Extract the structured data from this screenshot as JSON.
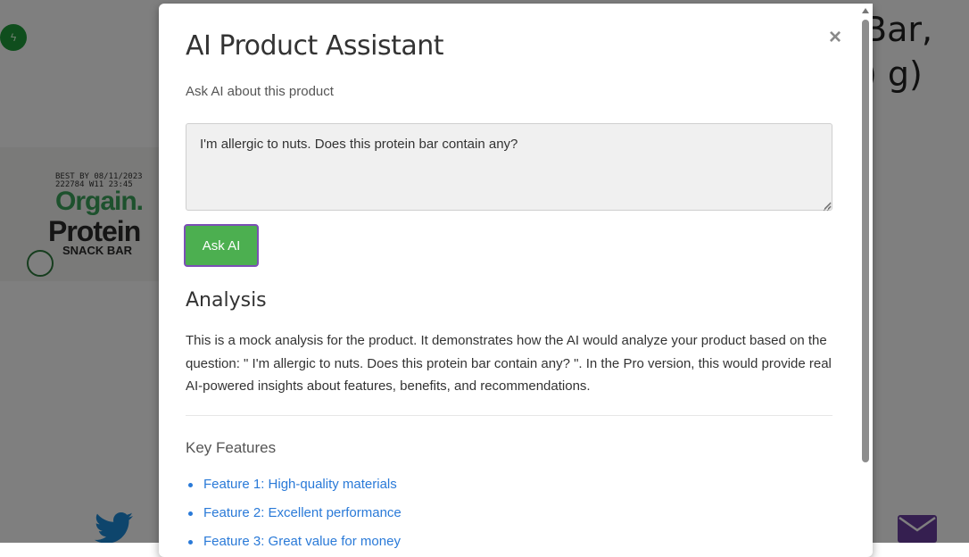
{
  "background": {
    "product_title_fragment_line1": "Bar,",
    "product_title_fragment_line2": ") g)",
    "product_image": {
      "best_by": "BEST BY 08/11/2023",
      "lot": "222784 W11      23:45",
      "brand": "Orgain.",
      "title": "Protein",
      "subtitle": "SNACK BAR"
    },
    "badge_icon": "lightning-icon"
  },
  "modal": {
    "title": "AI Product Assistant",
    "close_label": "×",
    "subtitle": "Ask AI about this product",
    "question_value": "I'm allergic to nuts. Does this protein bar contain any?",
    "ask_button_label": "Ask AI",
    "analysis_heading": "Analysis",
    "analysis_text": "This is a mock analysis for the product. It demonstrates how the AI would analyze your product based on the question: \" I'm allergic to nuts. Does this protein bar contain any? \". In the Pro version, this would provide real AI-powered insights about features, benefits, and recommendations.",
    "features_heading": "Key Features",
    "features": [
      "Feature 1: High-quality materials",
      "Feature 2: Excellent performance",
      "Feature 3: Great value for money"
    ]
  },
  "colors": {
    "accent_button": "#4caf50",
    "button_focus_border": "#7b4fb5",
    "link": "#2a7ad8",
    "overlay": "rgba(0,0,0,0.5)"
  }
}
